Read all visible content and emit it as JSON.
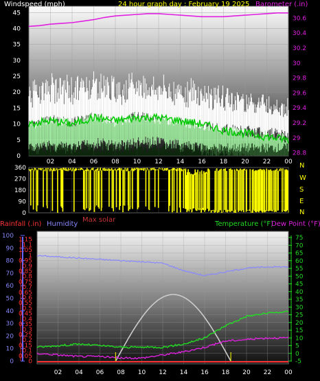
{
  "header": {
    "windspeed_label": "Windspeed (mph)",
    "title": "24 hour graph day : February 19 2025",
    "barometer_label": "Barometer (.in)"
  },
  "x_ticks": [
    "02",
    "04",
    "06",
    "08",
    "10",
    "12",
    "14",
    "16",
    "18",
    "20",
    "22",
    "00"
  ],
  "lower_labels": {
    "rainfall": "Rainfall (.in)",
    "humidity": "Humidity",
    "max_solar": "Max solar",
    "temperature": "Temperature (°F)",
    "dew_point": "Dew Point (°F)"
  },
  "direction_labels": [
    "N",
    "W",
    "S",
    "E",
    "N"
  ],
  "colors": {
    "windspeed": "#ffffff",
    "gust_band": "#aaffaa",
    "wind_avg": "#00cc00",
    "barometer": "#e020e0",
    "direction": "#ffff00",
    "rainfall": "#ff3333",
    "humidity": "#8888ff",
    "temperature": "#22dd22",
    "dew_point": "#dd22dd",
    "solar": "#cccccc"
  },
  "chart_data": [
    {
      "type": "line",
      "title": "24 hour graph day : February 19 2025",
      "x_hours": [
        0,
        2,
        4,
        6,
        8,
        10,
        12,
        14,
        16,
        18,
        20,
        22,
        24
      ],
      "x_tick_labels": [
        "02",
        "04",
        "06",
        "08",
        "10",
        "12",
        "14",
        "16",
        "18",
        "20",
        "22",
        "00"
      ],
      "y_left": {
        "label": "Windspeed (mph)",
        "ticks": [
          0,
          5,
          10,
          15,
          20,
          25,
          30,
          35,
          40,
          45
        ],
        "range": [
          0,
          47
        ]
      },
      "y_right": {
        "label": "Barometer (.in)",
        "ticks": [
          28.8,
          29,
          29.2,
          29.4,
          29.6,
          29.8,
          30,
          30.2,
          30.4,
          30.6
        ],
        "range": [
          28.76,
          30.76
        ]
      },
      "series": [
        {
          "name": "Barometer (.in)",
          "axis": "right",
          "x": [
            0,
            1,
            2,
            3,
            4,
            5,
            6,
            7,
            8,
            9,
            10,
            11,
            12,
            13,
            14,
            15,
            16,
            17,
            18,
            19,
            20,
            21,
            22,
            23,
            24
          ],
          "values": [
            30.49,
            30.5,
            30.52,
            30.53,
            30.54,
            30.56,
            30.58,
            30.61,
            30.63,
            30.64,
            30.65,
            30.66,
            30.66,
            30.65,
            30.64,
            30.63,
            30.62,
            30.62,
            30.62,
            30.63,
            30.64,
            30.65,
            30.66,
            30.67,
            30.67
          ]
        },
        {
          "name": "Windspeed (mph)",
          "axis": "left",
          "x": [
            0,
            2,
            4,
            6,
            8,
            10,
            12,
            14,
            16,
            18,
            20,
            22,
            24
          ],
          "values": [
            14,
            16,
            15,
            17,
            15,
            17,
            16,
            15,
            14,
            13,
            13,
            12,
            11
          ]
        },
        {
          "name": "Wind average",
          "axis": "left",
          "x": [
            0,
            2,
            4,
            6,
            8,
            10,
            12,
            14,
            16,
            18,
            20,
            22,
            24
          ],
          "values": [
            10,
            11,
            10,
            12,
            11,
            12,
            12,
            11,
            10,
            8,
            7,
            6,
            5
          ]
        },
        {
          "name": "Gust",
          "axis": "left",
          "x": [
            0,
            2,
            4,
            6,
            8,
            10,
            12,
            14,
            16,
            18,
            20,
            22,
            24
          ],
          "values": [
            22,
            24,
            23,
            25,
            23,
            24,
            23,
            22,
            22,
            20,
            19,
            18,
            16
          ]
        }
      ]
    },
    {
      "type": "scatter",
      "y_left": {
        "ticks": [
          0,
          90,
          180,
          270,
          360
        ],
        "range": [
          0,
          360
        ]
      },
      "y_right_labels": [
        "N",
        "W",
        "S",
        "E",
        "N"
      ],
      "note": "wind direction",
      "x_hours": [
        0,
        24
      ]
    },
    {
      "type": "line",
      "y_humidity": {
        "ticks": [
          0,
          10,
          20,
          30,
          40,
          50,
          60,
          70,
          80,
          90,
          100
        ],
        "range": [
          0,
          100
        ]
      },
      "y_rainfall": {
        "ticks": [
          0,
          0.05,
          0.1,
          0.15,
          0.2,
          0.25,
          0.3,
          0.35,
          0.4,
          0.45,
          0.5,
          0.55,
          0.6,
          0.65,
          0.7,
          0.75,
          0.8,
          0.85,
          0.9,
          0.95,
          1,
          1.05,
          1.1,
          1.15
        ],
        "range": [
          0,
          1.2
        ]
      },
      "y_temperature": {
        "ticks": [
          -5,
          0,
          5,
          10,
          15,
          20,
          25,
          30,
          35,
          40,
          45,
          50,
          55,
          60,
          65,
          70,
          75
        ],
        "range": [
          -6,
          77
        ]
      },
      "series": [
        {
          "name": "Humidity",
          "axis": "humidity",
          "x": [
            0,
            2,
            4,
            6,
            8,
            10,
            12,
            14,
            16,
            18,
            20,
            22,
            24
          ],
          "values": [
            84,
            83,
            82,
            81,
            80,
            79,
            78,
            72,
            68,
            71,
            74,
            75,
            75
          ]
        },
        {
          "name": "Temperature (°F)",
          "axis": "temperature",
          "x": [
            0,
            2,
            4,
            6,
            8,
            10,
            12,
            14,
            16,
            18,
            20,
            22,
            24
          ],
          "values": [
            4,
            5,
            6,
            5,
            4,
            4,
            4,
            6,
            10,
            18,
            24,
            26,
            27
          ]
        },
        {
          "name": "Dew Point (°F)",
          "axis": "temperature",
          "x": [
            0,
            2,
            4,
            6,
            8,
            10,
            12,
            14,
            16,
            18,
            20,
            22,
            24
          ],
          "values": [
            0,
            -1,
            -2,
            -2,
            -3,
            -3,
            -1,
            1,
            4,
            8,
            9,
            10,
            10
          ]
        },
        {
          "name": "Max solar",
          "axis": "humidity",
          "x": [
            7.5,
            8,
            9,
            10,
            11,
            12,
            13,
            14,
            15,
            16,
            17,
            18,
            18.5
          ],
          "values": [
            0,
            5,
            14,
            24,
            34,
            42,
            49,
            53,
            48,
            38,
            24,
            10,
            0
          ]
        },
        {
          "name": "Rainfall (.in)",
          "axis": "rainfall",
          "x": [
            0,
            24
          ],
          "values": [
            0,
            0
          ]
        }
      ]
    }
  ]
}
